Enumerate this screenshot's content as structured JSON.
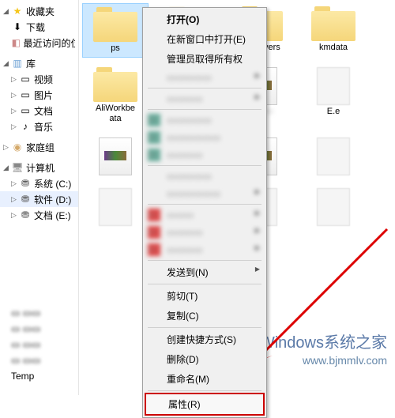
{
  "sidebar": {
    "favorites": {
      "label": "收藏夹",
      "items": [
        "下载",
        "最近访问的位置"
      ]
    },
    "libraries": {
      "label": "库",
      "items": [
        "视频",
        "图片",
        "文档",
        "音乐"
      ]
    },
    "homegroup": {
      "label": "家庭组"
    },
    "computer": {
      "label": "计算机",
      "items": [
        "系统 (C:)",
        "软件 (D:)",
        "文档 (E:)"
      ]
    },
    "bottom": {
      "label": "Temp"
    }
  },
  "files": {
    "row1": [
      {
        "name": "ps",
        "type": "folder",
        "selected": true
      },
      {
        "name": "",
        "type": "folder"
      },
      {
        "name": "MyDrivers",
        "type": "folder"
      },
      {
        "name": "kmdata",
        "type": "folder"
      }
    ],
    "row2": [
      {
        "name": "AliWorkbe",
        "name2": "ata",
        "type": "folder"
      },
      {
        "name": "",
        "type": "rar"
      },
      {
        "name": "E.e",
        "type": "generic"
      }
    ],
    "row3": [
      {
        "name": "",
        "type": "rar"
      },
      {
        "name": "",
        "type": "rar"
      },
      {
        "name": "",
        "type": "generic"
      }
    ],
    "row4": [
      {
        "name": "",
        "type": "generic"
      },
      {
        "name": "",
        "type": "generic"
      },
      {
        "name": "",
        "type": "generic"
      }
    ]
  },
  "context_menu": {
    "open": "打开(O)",
    "open_new": "在新窗口中打开(E)",
    "admin": "管理员取得所有权",
    "send_to": "发送到(N)",
    "cut": "剪切(T)",
    "copy": "复制(C)",
    "shortcut": "创建快捷方式(S)",
    "delete": "删除(D)",
    "rename": "重命名(M)",
    "properties": "属性(R)"
  },
  "watermark": {
    "text": "Windows系统之家",
    "url": "www.bjmmlv.com"
  }
}
